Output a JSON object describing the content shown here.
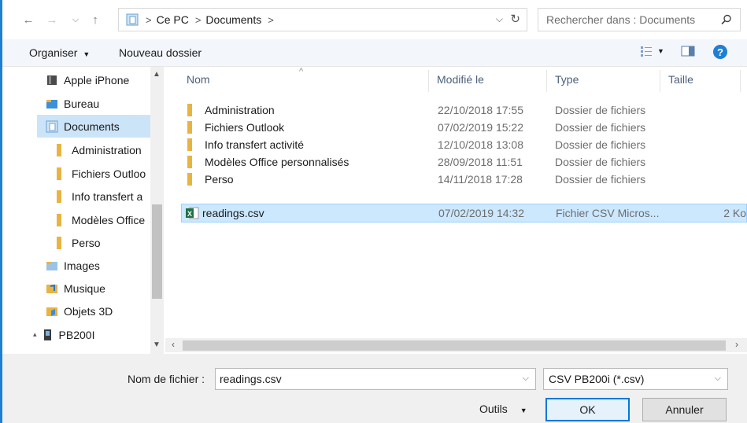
{
  "address_bar": {
    "crumbs": [
      "Ce PC",
      "Documents"
    ],
    "separator": ">",
    "search_placeholder": "Rechercher dans : Documents"
  },
  "toolbar": {
    "organize_label": "Organiser",
    "new_folder_label": "Nouveau dossier"
  },
  "nav_pane": {
    "items": [
      {
        "label": "Apple iPhone",
        "icon": "phone-icon"
      },
      {
        "label": "Bureau",
        "icon": "desktop-folder-icon"
      },
      {
        "label": "Documents",
        "icon": "documents-folder-icon",
        "selected": true
      },
      {
        "label": "Administration",
        "icon": "folder-icon"
      },
      {
        "label": "Fichiers Outloo",
        "icon": "folder-icon"
      },
      {
        "label": "Info transfert a",
        "icon": "folder-icon"
      },
      {
        "label": "Modèles Office",
        "icon": "folder-icon"
      },
      {
        "label": "Perso",
        "icon": "folder-icon"
      },
      {
        "label": "Images",
        "icon": "pictures-folder-icon"
      },
      {
        "label": "Musique",
        "icon": "music-folder-icon"
      },
      {
        "label": "Objets 3D",
        "icon": "3d-objects-folder-icon"
      },
      {
        "label": "PB200I",
        "icon": "device-icon"
      }
    ]
  },
  "file_list": {
    "columns": [
      "Nom",
      "Modifié le",
      "Type",
      "Taille"
    ],
    "rows": [
      {
        "name": "Administration",
        "date": "22/10/2018 17:55",
        "type": "Dossier de fichiers",
        "size": "",
        "icon": "folder-icon"
      },
      {
        "name": "Fichiers Outlook",
        "date": "07/02/2019 15:22",
        "type": "Dossier de fichiers",
        "size": "",
        "icon": "folder-icon"
      },
      {
        "name": "Info transfert activité",
        "date": "12/10/2018 13:08",
        "type": "Dossier de fichiers",
        "size": "",
        "icon": "folder-icon"
      },
      {
        "name": "Modèles Office personnalisés",
        "date": "28/09/2018 11:51",
        "type": "Dossier de fichiers",
        "size": "",
        "icon": "folder-icon"
      },
      {
        "name": "Perso",
        "date": "14/11/2018 17:28",
        "type": "Dossier de fichiers",
        "size": "",
        "icon": "folder-icon"
      },
      {
        "name": "readings.csv",
        "date": "07/02/2019 14:32",
        "type": "Fichier CSV Micros...",
        "size": "2 Ko",
        "icon": "excel-csv-icon",
        "selected": true
      }
    ]
  },
  "bottom": {
    "filename_label": "Nom de fichier :",
    "filename_value": "readings.csv",
    "filter_value": "CSV PB200i (*.csv)",
    "tools_label": "Outils",
    "ok_label": "OK",
    "cancel_label": "Annuler"
  },
  "colors": {
    "accent": "#0078d7",
    "selection": "#cce8ff",
    "nav_selection": "#cce4f7",
    "folder": "#e8b441",
    "help": "#1e7fd4"
  }
}
